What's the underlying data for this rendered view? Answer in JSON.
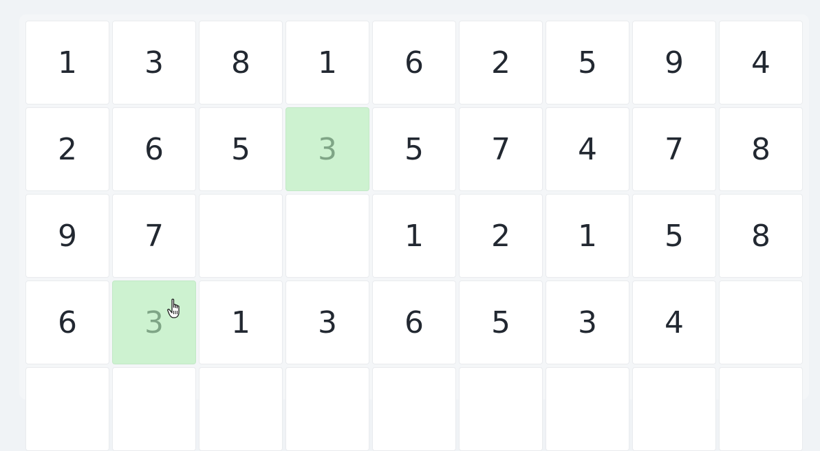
{
  "board": {
    "rows": [
      [
        "1",
        "3",
        "8",
        "1",
        "6",
        "2",
        "5",
        "9",
        "4"
      ],
      [
        "2",
        "6",
        "5",
        "3",
        "5",
        "7",
        "4",
        "7",
        "8"
      ],
      [
        "9",
        "7",
        "",
        "",
        "1",
        "2",
        "1",
        "5",
        "8"
      ],
      [
        "6",
        "3",
        "1",
        "3",
        "6",
        "5",
        "3",
        "4",
        ""
      ],
      [
        "",
        "",
        "",
        "",
        "",
        "",
        "",
        "",
        ""
      ]
    ],
    "selected": [
      [
        1,
        3
      ],
      [
        3,
        1
      ]
    ]
  },
  "colors": {
    "selected_bg": "#cdf2d0",
    "selected_text": "#7fa586",
    "text": "#222831"
  }
}
